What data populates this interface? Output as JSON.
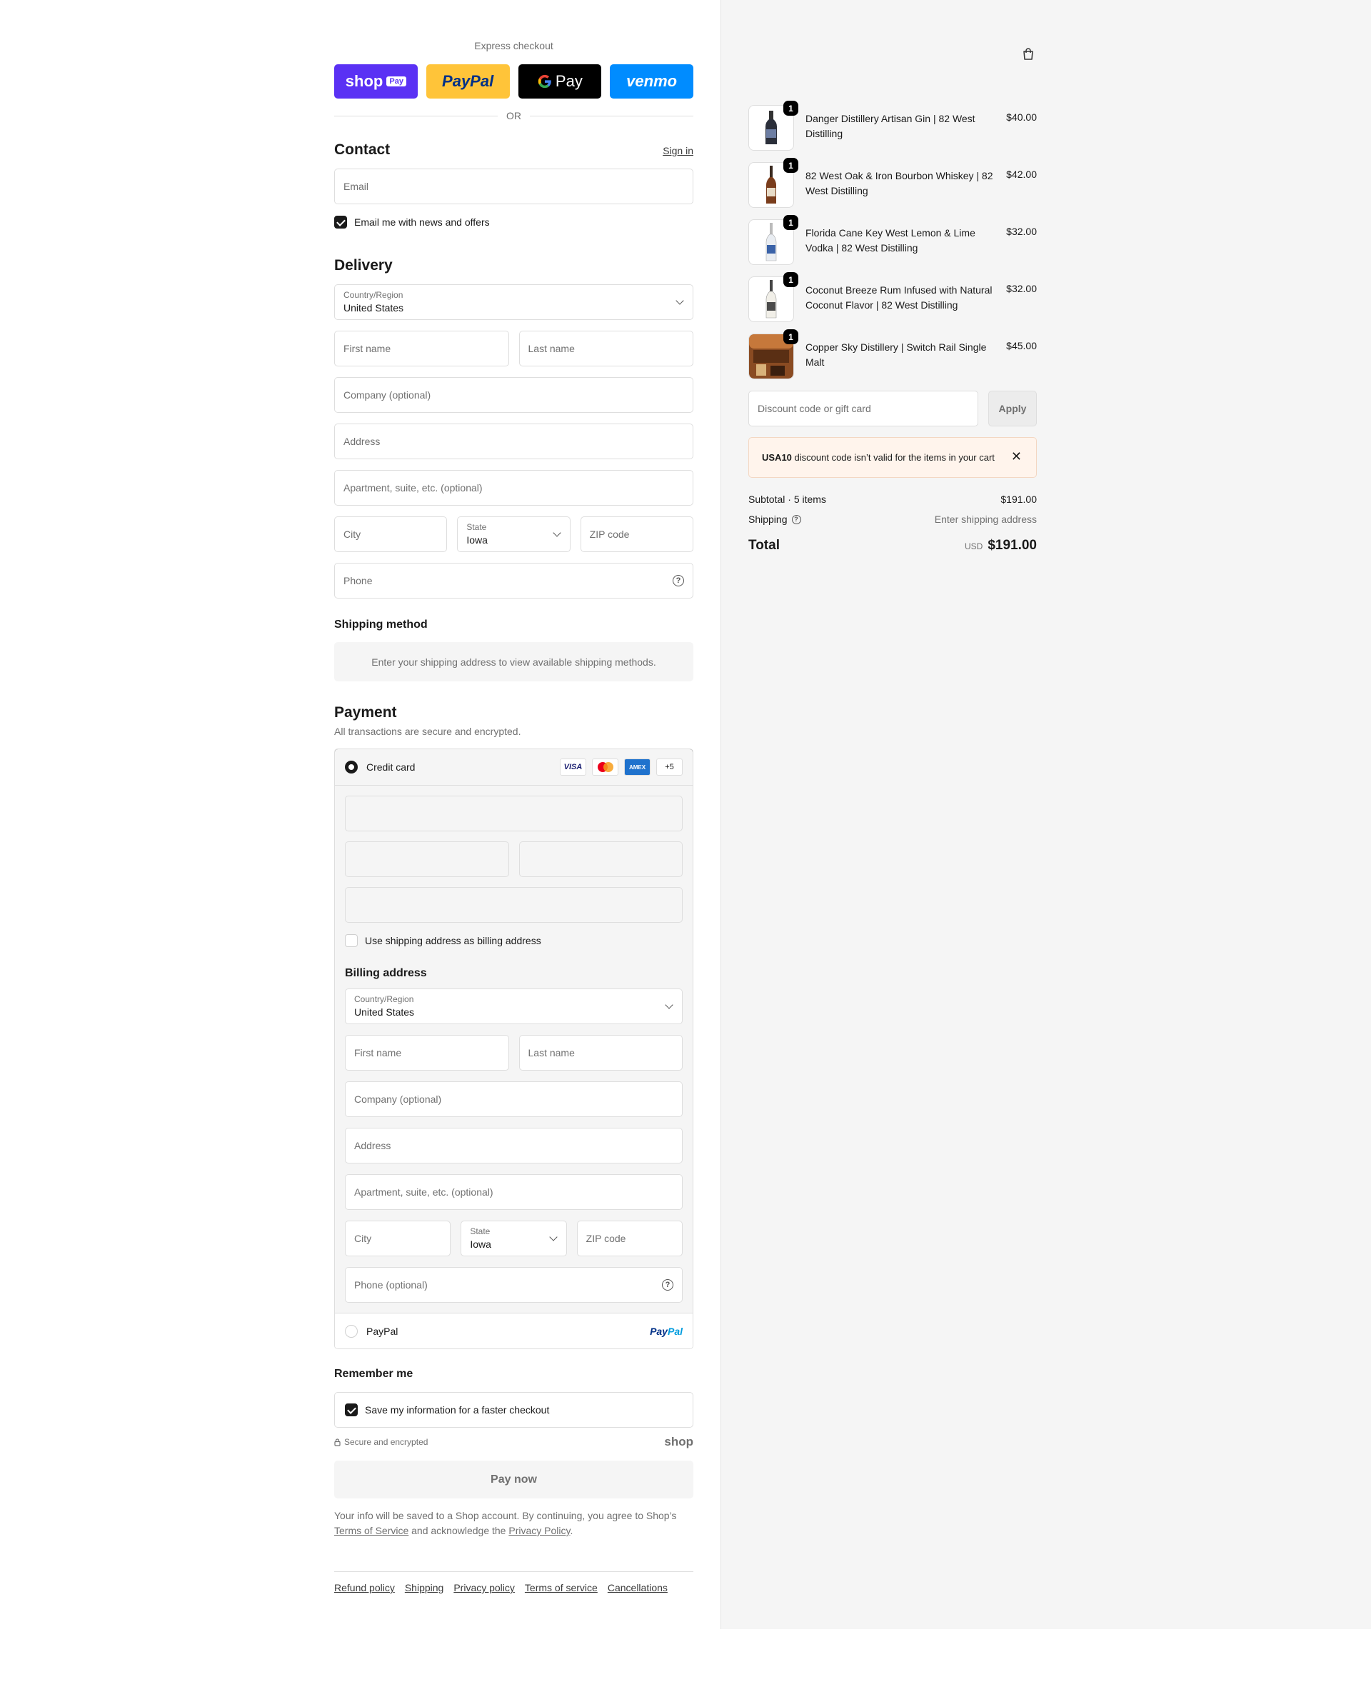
{
  "express": {
    "label": "Express checkout",
    "shop_pay": "shop",
    "shop_pay_badge": "Pay",
    "paypal": "PayPal",
    "gpay": "Pay",
    "venmo": "venmo",
    "or": "OR"
  },
  "contact": {
    "title": "Contact",
    "sign_in": "Sign in",
    "email_placeholder": "Email",
    "newsletter": "Email me with news and offers"
  },
  "delivery": {
    "title": "Delivery",
    "country_label": "Country/Region",
    "country_value": "United States",
    "first_name": "First name",
    "last_name": "Last name",
    "company": "Company (optional)",
    "address": "Address",
    "apartment": "Apartment, suite, etc. (optional)",
    "city": "City",
    "state_label": "State",
    "state_value": "Iowa",
    "zip": "ZIP code",
    "phone": "Phone"
  },
  "shipping_method": {
    "title": "Shipping method",
    "note": "Enter your shipping address to view available shipping methods."
  },
  "payment": {
    "title": "Payment",
    "subtitle": "All transactions are secure and encrypted.",
    "credit_card": "Credit card",
    "cards": [
      "VISA",
      "AMEX",
      "+5"
    ],
    "use_shipping": "Use shipping address as billing address",
    "paypal": "PayPal",
    "paypal_logo_a": "Pay",
    "paypal_logo_b": "Pal"
  },
  "billing": {
    "title": "Billing address",
    "country_label": "Country/Region",
    "country_value": "United States",
    "first_name": "First name",
    "last_name": "Last name",
    "company": "Company (optional)",
    "address": "Address",
    "apartment": "Apartment, suite, etc. (optional)",
    "city": "City",
    "state_label": "State",
    "state_value": "Iowa",
    "zip": "ZIP code",
    "phone": "Phone (optional)"
  },
  "remember": {
    "title": "Remember me",
    "save": "Save my information for a faster checkout",
    "secure": "Secure and encrypted",
    "shop": "shop"
  },
  "pay_now": "Pay now",
  "legal": {
    "part1": "Your info will be saved to a Shop account. By continuing, you agree to Shop’s",
    "tos": "Terms of Service",
    "part2": "and acknowledge the",
    "privacy": "Privacy Policy",
    "part3": "."
  },
  "footer": [
    "Refund policy",
    "Shipping",
    "Privacy policy",
    "Terms of service",
    "Cancellations"
  ],
  "cart": {
    "items": [
      {
        "name": "Danger Distillery Artisan Gin | 82 West Distilling",
        "price": "$40.00",
        "qty": "1"
      },
      {
        "name": "82 West Oak & Iron Bourbon Whiskey | 82 West Distilling",
        "price": "$42.00",
        "qty": "1"
      },
      {
        "name": "Florida Cane Key West Lemon & Lime Vodka | 82 West Distilling",
        "price": "$32.00",
        "qty": "1"
      },
      {
        "name": "Coconut Breeze Rum Infused with Natural Coconut Flavor | 82 West Distilling",
        "price": "$32.00",
        "qty": "1"
      },
      {
        "name": "Copper Sky Distillery | Switch Rail Single Malt",
        "price": "$45.00",
        "qty": "1"
      }
    ],
    "discount_placeholder": "Discount code or gift card",
    "apply": "Apply",
    "notice_code": "USA10",
    "notice_text": "discount code isn’t valid for the items in your cart",
    "subtotal_label": "Subtotal · 5 items",
    "subtotal": "$191.00",
    "shipping_label": "Shipping",
    "shipping_value": "Enter shipping address",
    "total_label": "Total",
    "currency": "USD",
    "total": "$191.00"
  }
}
